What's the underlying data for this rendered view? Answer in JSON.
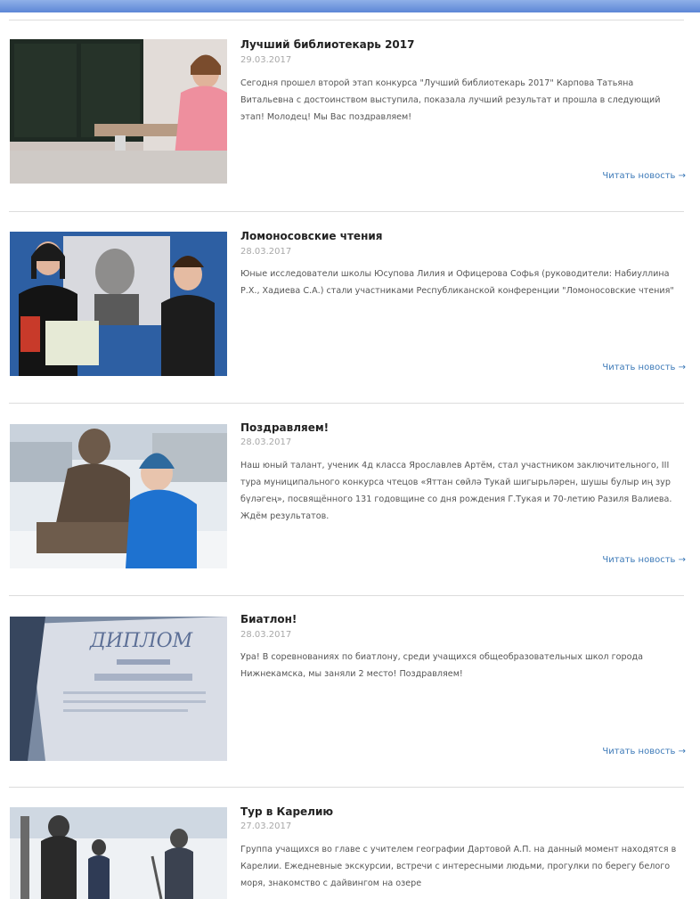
{
  "news": [
    {
      "title": "Лучший библиотекарь 2017",
      "date": "29.03.2017",
      "text": "Сегодня прошел второй этап конкурса \"Лучший библиотекарь 2017\" Карпова Татьяна Витальевна с достоинством выступила, показала лучший результат и прошла в следующий этап! Молодец! Мы Вас поздравляем!",
      "read_more": "Читать новость →"
    },
    {
      "title": "Ломоносовские чтения",
      "date": "28.03.2017",
      "text": "Юные исследователи школы Юсупова Лилия и Офицерова Софья (руководители: Набиуллина Р.Х., Хадиева С.А.) стали участниками Республиканской конференции \"Ломоносовские чтения\"",
      "read_more": "Читать новость →"
    },
    {
      "title": "Поздравляем!",
      "date": "28.03.2017",
      "text": "Наш юный талант, ученик 4д класса Ярославлев Артём, стал участником заключительного, III тура муниципального конкурса чтецов «Яттан сөйлә Тукай шигырьләрен, шушы булыр иң зур бүләгең», посвящённого 131 годовщине со дня рождения Г.Тукая и 70-летию Разиля Валиева. Ждём результатов.",
      "read_more": "Читать новость →"
    },
    {
      "title": "Биатлон!",
      "date": "28.03.2017",
      "text": "Ура! В соревнованиях по биатлону, среди учащихся общеобразовательных школ города Нижнекамска, мы заняли 2 место! Поздравляем!",
      "read_more": "Читать новость →",
      "image_text": "ДИПЛОМ"
    },
    {
      "title": "Тур в Карелию",
      "date": "27.03.2017",
      "text": "Группа учащихся во главе с учителем географии Дартовой А.П. на данный момент находятся в Карелии. Ежедневные экскурсии, встречи с интересными людьми, прогулки по берегу белого моря, знакомство с дайвингом на озере",
      "read_more": ""
    }
  ],
  "colors": {
    "link": "#3d7ab8",
    "date": "#a8a8a8",
    "topbar": "#6a91dc"
  },
  "icons": {
    "read_more_arrow": "right-arrow-icon"
  }
}
